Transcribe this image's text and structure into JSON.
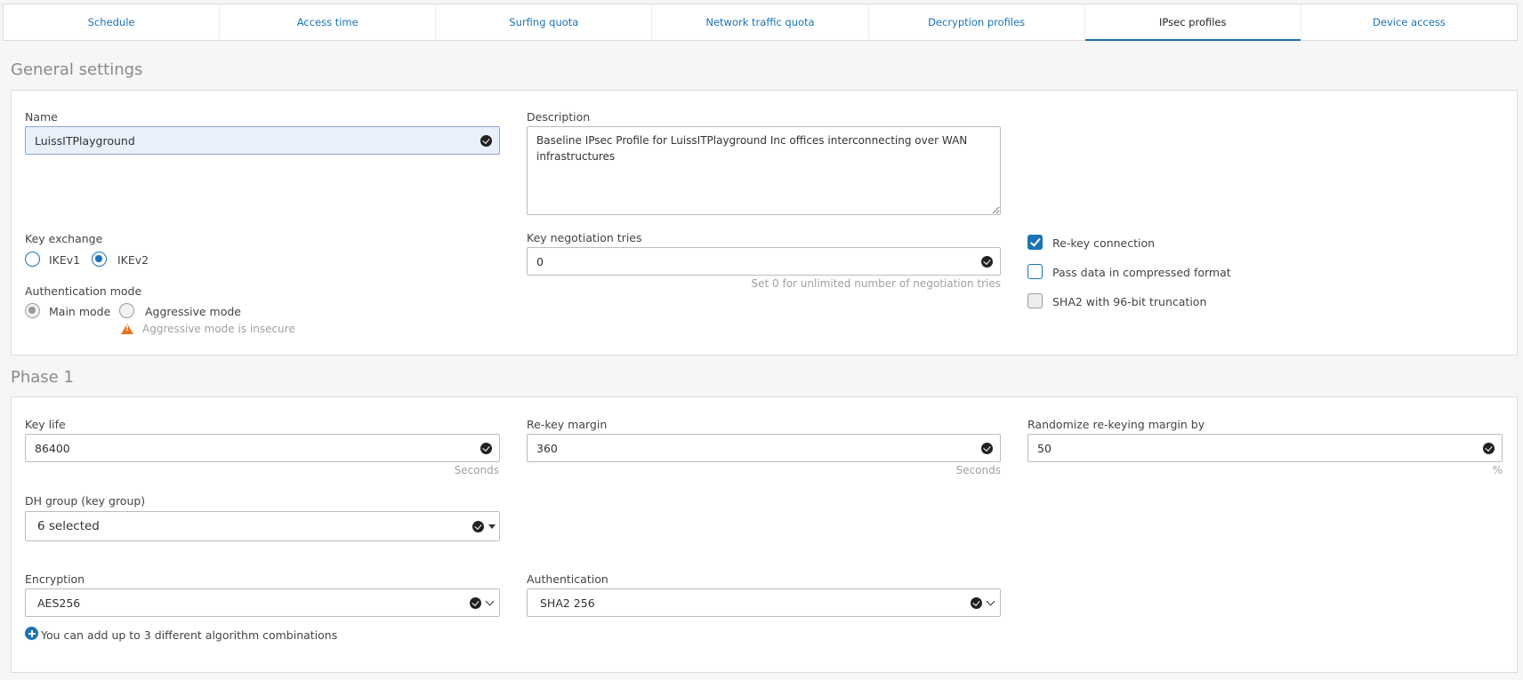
{
  "tabs": [
    {
      "label": "Schedule"
    },
    {
      "label": "Access time"
    },
    {
      "label": "Surfing quota"
    },
    {
      "label": "Network traffic quota"
    },
    {
      "label": "Decryption profiles"
    },
    {
      "label": "IPsec profiles"
    },
    {
      "label": "Device access"
    }
  ],
  "active_tab": "IPsec profiles",
  "general": {
    "title": "General settings",
    "name_label": "Name",
    "name_value": "LuissITPlayground",
    "description_label": "Description",
    "description_value": "Baseline IPsec Profile for LuissITPlayground Inc offices interconnecting over WAN infrastructures",
    "key_exchange_label": "Key exchange",
    "ikev1_label": "IKEv1",
    "ikev2_label": "IKEv2",
    "key_exchange_selected": "IKEv2",
    "auth_mode_label": "Authentication mode",
    "main_mode_label": "Main mode",
    "aggressive_mode_label": "Aggressive mode",
    "auth_mode_selected": "Main mode",
    "aggressive_warning": "Aggressive mode is insecure",
    "key_negotiation_label": "Key negotiation tries",
    "key_negotiation_value": "0",
    "key_negotiation_hint": "Set 0 for unlimited number of negotiation tries",
    "rekey_label": "Re-key connection",
    "rekey_checked": true,
    "compressed_label": "Pass data in compressed format",
    "compressed_checked": false,
    "sha2_label": "SHA2 with 96-bit truncation",
    "sha2_checked": false
  },
  "phase1": {
    "title": "Phase 1",
    "key_life_label": "Key life",
    "key_life_value": "86400",
    "key_life_unit": "Seconds",
    "rekey_margin_label": "Re-key margin",
    "rekey_margin_value": "360",
    "rekey_margin_unit": "Seconds",
    "randomize_label": "Randomize re-keying margin by",
    "randomize_value": "50",
    "randomize_unit": "%",
    "dh_group_label": "DH group (key group)",
    "dh_group_value": "6 selected",
    "encryption_label": "Encryption",
    "encryption_value": "AES256",
    "authentication_label": "Authentication",
    "authentication_value": "SHA2 256",
    "add_combination_text": "You can add up to 3 different algorithm combinations"
  },
  "colors": {
    "accent": "#1a73b5",
    "warning": "#e8731a",
    "highlight_field": "#e8f0fc"
  }
}
